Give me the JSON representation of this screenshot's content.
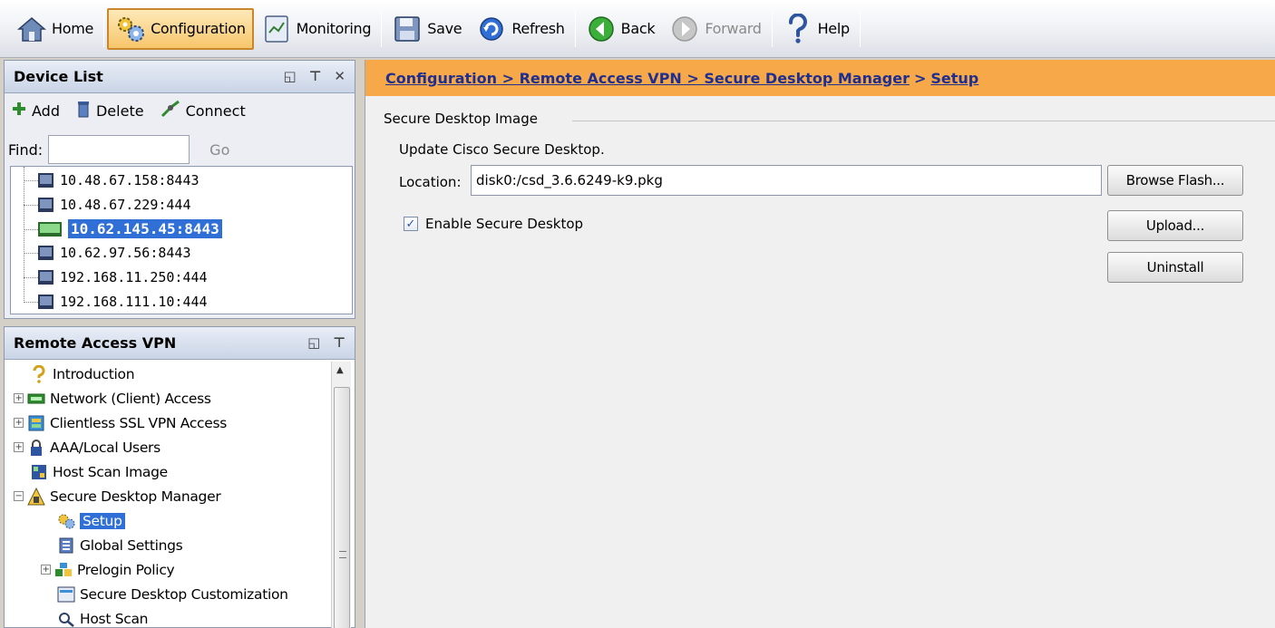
{
  "toolbar": {
    "items": [
      {
        "label": "Home",
        "icon": "home-icon"
      },
      {
        "label": "Configuration",
        "icon": "configuration-gears-icon",
        "active": true
      },
      {
        "label": "Monitoring",
        "icon": "monitoring-icon"
      },
      {
        "label": "Save",
        "icon": "save-floppy-icon"
      },
      {
        "label": "Refresh",
        "icon": "refresh-icon"
      },
      {
        "label": "Back",
        "icon": "back-arrow-icon"
      },
      {
        "label": "Forward",
        "icon": "forward-arrow-icon",
        "disabled": true
      },
      {
        "label": "Help",
        "icon": "help-question-icon"
      }
    ]
  },
  "device_list": {
    "title": "Device List",
    "actions": {
      "add": "Add",
      "delete": "Delete",
      "connect": "Connect"
    },
    "find_label": "Find:",
    "find_value": "",
    "go_label": "Go",
    "devices": [
      "10.48.67.158:8443",
      "10.48.67.229:444",
      "10.62.145.45:8443",
      "10.62.97.56:8443",
      "192.168.11.250:444",
      "192.168.111.10:444"
    ],
    "selected_device": "10.62.145.45:8443"
  },
  "nav": {
    "title": "Remote Access VPN",
    "items": [
      {
        "label": "Introduction",
        "icon": "question-icon",
        "level": 0,
        "expander": "none"
      },
      {
        "label": "Network (Client) Access",
        "icon": "network-client-icon",
        "level": 0,
        "expander": "+"
      },
      {
        "label": "Clientless SSL VPN Access",
        "icon": "clientless-vpn-icon",
        "level": 0,
        "expander": "+"
      },
      {
        "label": "AAA/Local Users",
        "icon": "users-lock-icon",
        "level": 0,
        "expander": "+"
      },
      {
        "label": "Host Scan Image",
        "icon": "host-scan-image-icon",
        "level": 0,
        "expander": "none"
      },
      {
        "label": "Secure Desktop Manager",
        "icon": "secure-desktop-icon",
        "level": 0,
        "expander": "-"
      },
      {
        "label": "Setup",
        "icon": "setup-gears-icon",
        "level": 1,
        "expander": "none",
        "selected": true
      },
      {
        "label": "Global Settings",
        "icon": "global-settings-icon",
        "level": 1,
        "expander": "none"
      },
      {
        "label": "Prelogin Policy",
        "icon": "prelogin-policy-icon",
        "level": 1,
        "expander": "+"
      },
      {
        "label": "Secure Desktop Customization",
        "icon": "customization-icon",
        "level": 1,
        "expander": "none"
      },
      {
        "label": "Host Scan",
        "icon": "host-scan-icon",
        "level": 1,
        "expander": "none"
      }
    ]
  },
  "breadcrumb": {
    "parts": [
      "Configuration > Remote Access VPN > Secure Desktop Manager",
      "Setup"
    ],
    "separator": ">"
  },
  "content": {
    "group_title": "Secure Desktop Image",
    "update_text": "Update Cisco Secure Desktop.",
    "location_label": "Location:",
    "location_value": "disk0:/csd_3.6.6249-k9.pkg",
    "enable_label": "Enable Secure Desktop",
    "enable_checked": true,
    "buttons": {
      "browse": "Browse Flash...",
      "upload": "Upload...",
      "uninstall": "Uninstall"
    }
  },
  "colors": {
    "breadcrumb_bg": "#f7a94a",
    "breadcrumb_text": "#1f2f8f",
    "selection": "#2f6fd6",
    "active_button_border": "#c9862a"
  }
}
